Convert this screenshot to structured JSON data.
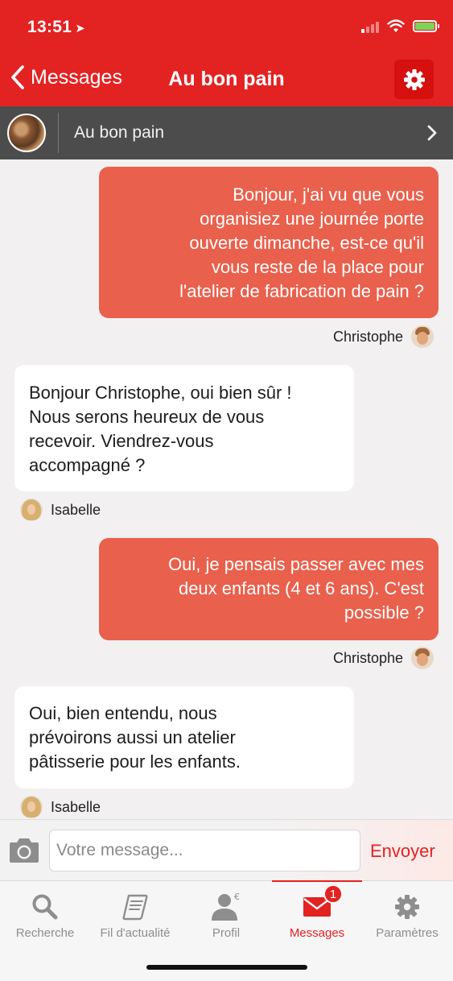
{
  "status_bar": {
    "time": "13:51",
    "location_icon": "location-arrow-icon"
  },
  "nav": {
    "back_label": "Messages",
    "title": "Au bon pain",
    "settings_icon": "gear-icon"
  },
  "conversation": {
    "name": "Au bon pain"
  },
  "messages": [
    {
      "direction": "out",
      "sender": "Christophe",
      "lines": [
        "Bonjour, j'ai vu que vous",
        "organisiez une journée porte",
        "ouverte dimanche, est-ce qu'il",
        "vous reste de la place pour",
        "l'atelier de fabrication de pain ?"
      ]
    },
    {
      "direction": "in",
      "sender": "Isabelle",
      "lines": [
        "Bonjour Christophe, oui bien sûr !",
        "Nous serons heureux de vous",
        "recevoir. Viendrez-vous",
        "accompagné ?"
      ]
    },
    {
      "direction": "out",
      "sender": "Christophe",
      "lines": [
        "Oui, je pensais passer avec mes",
        "deux enfants (4 et 6 ans). C'est",
        "possible ?"
      ]
    },
    {
      "direction": "in",
      "sender": "Isabelle",
      "lines": [
        "Oui, bien entendu, nous",
        "prévoirons aussi un atelier",
        "pâtisserie pour les enfants."
      ]
    }
  ],
  "composer": {
    "placeholder": "Votre message...",
    "send_label": "Envoyer"
  },
  "tabs": [
    {
      "label": "Recherche",
      "icon": "search-icon"
    },
    {
      "label": "Fil d'actualité",
      "icon": "scroll-icon"
    },
    {
      "label": "Profil",
      "icon": "profile-icon"
    },
    {
      "label": "Messages",
      "icon": "envelope-icon",
      "badge": "1",
      "active": true
    },
    {
      "label": "Paramètres",
      "icon": "gear-icon"
    }
  ],
  "colors": {
    "primary": "#e32222",
    "outgoing_bubble": "#e9604c",
    "incoming_bubble": "#ffffff"
  }
}
